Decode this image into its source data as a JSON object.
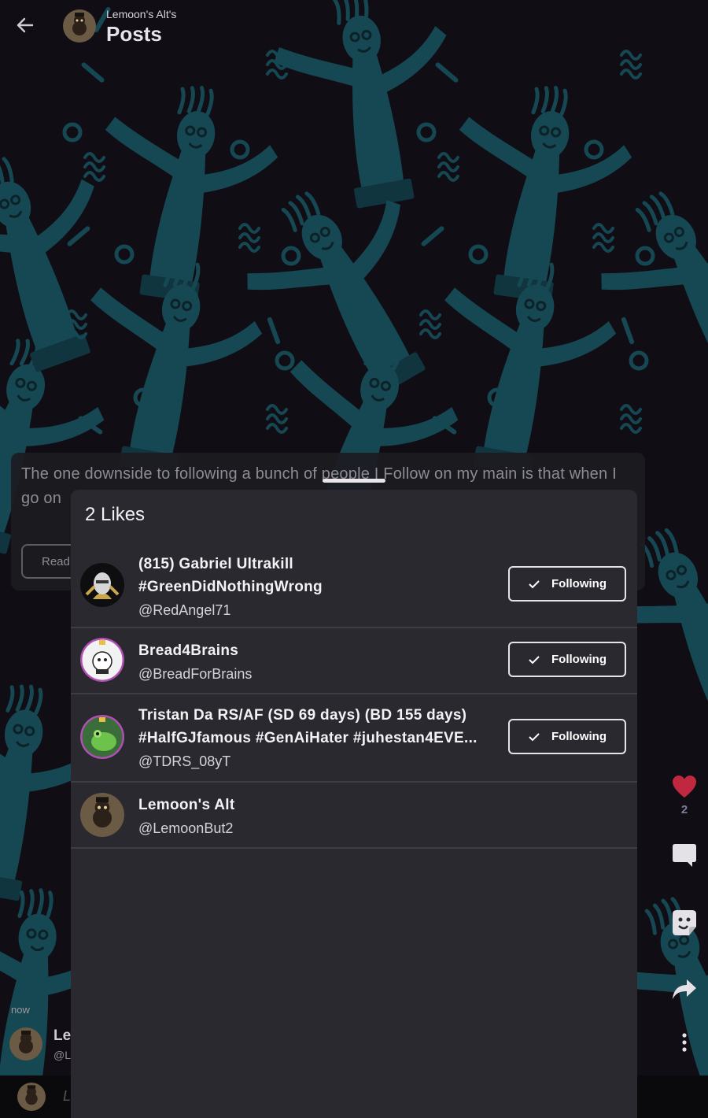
{
  "header": {
    "subtitle": "Lemoon's Alt's",
    "title": "Posts"
  },
  "post": {
    "text": "The one downside to following a bunch of people I Follow on my main is that when I go on",
    "read_label": "Read",
    "timestamp": "now",
    "author_name": "Lemoon's Alt",
    "author_handle": "@LemoonBut2",
    "like_count": "2"
  },
  "comment_bar": {
    "placeholder": "L"
  },
  "likes_sheet": {
    "title": "2 Likes",
    "users": [
      {
        "name_line1": "(815) Gabriel Ultrakill",
        "name_line2": "#GreenDidNothingWrong",
        "handle": "@RedAngel71",
        "follow_label": "Following"
      },
      {
        "name_line1": "Bread4Brains",
        "name_line2": "",
        "handle": "@BreadForBrains",
        "follow_label": "Following"
      },
      {
        "name_line1": "Tristan Da RS/AF (SD 69 days) (BD 155 days)",
        "name_line2": "#HalfGJfamous #GenAiHater #juhestan4EVE...",
        "handle": "@TDRS_08yT",
        "follow_label": "Following"
      },
      {
        "name_line1": "Lemoon's Alt",
        "name_line2": "",
        "handle": "@LemoonBut2",
        "follow_label": ""
      }
    ]
  },
  "colors": {
    "accent_like": "#c0283f",
    "wallpaper_figure": "#1e6a78",
    "sheet_bg": "#2a292f"
  },
  "icons": [
    "back-arrow-icon",
    "heart-icon",
    "comment-icon",
    "sticker-icon",
    "share-icon",
    "more-vertical-icon",
    "check-icon"
  ]
}
